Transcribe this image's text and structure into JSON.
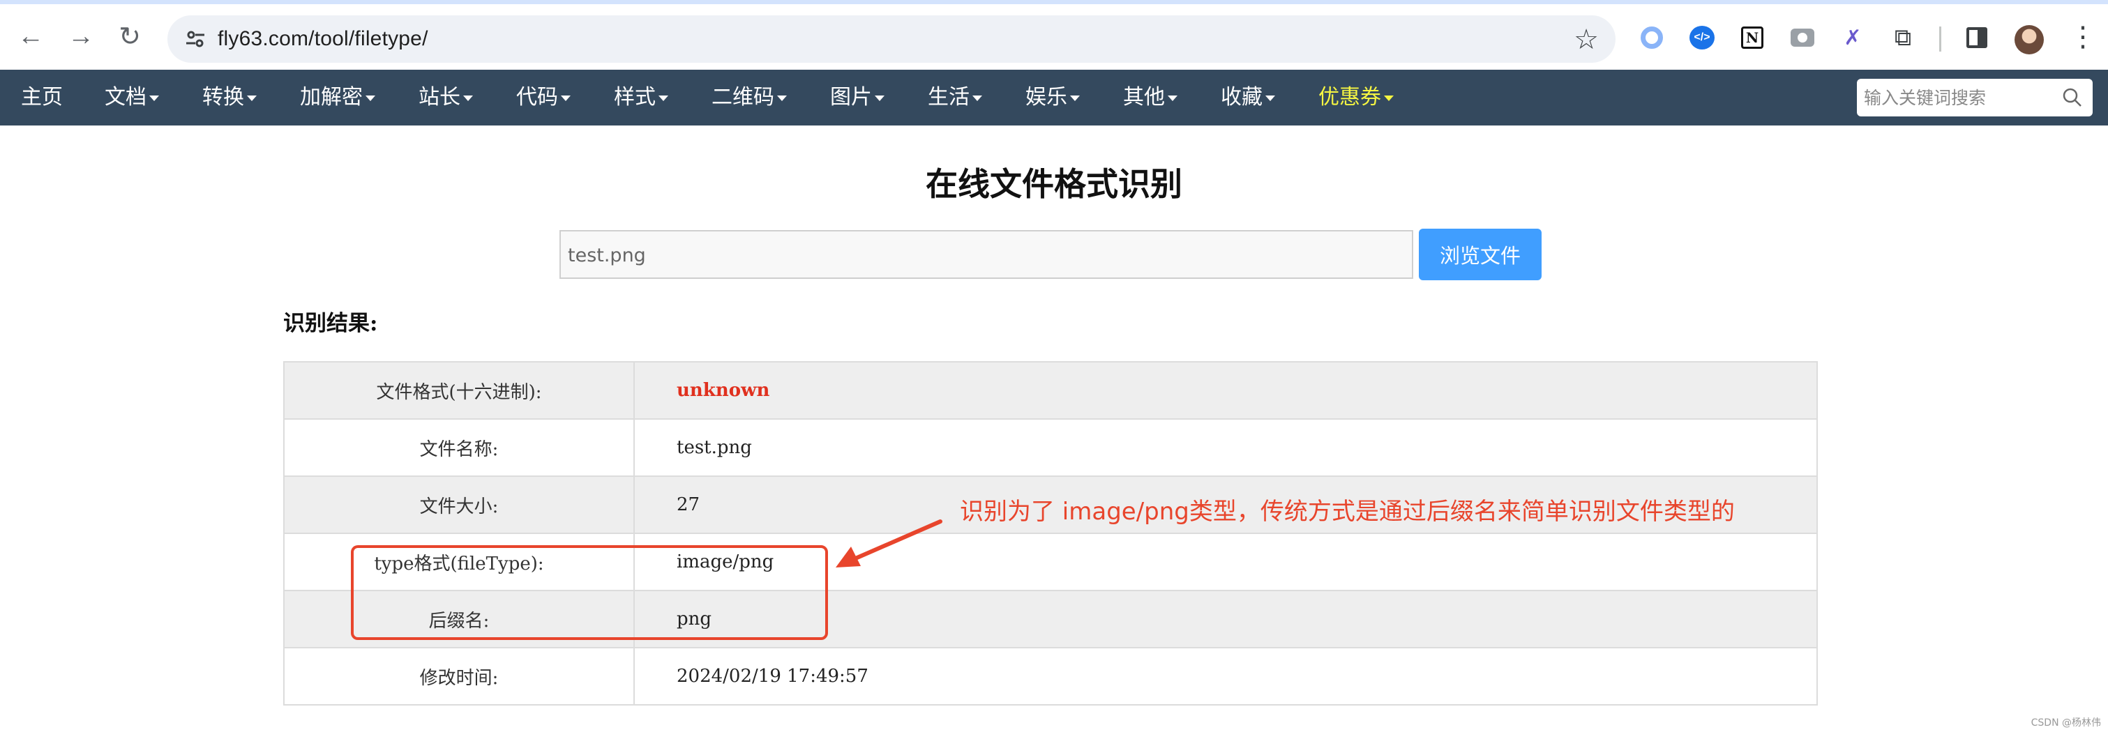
{
  "browser": {
    "url": "fly63.com/tool/filetype/"
  },
  "site_nav": {
    "items": [
      {
        "label": "主页",
        "has_caret": false
      },
      {
        "label": "文档",
        "has_caret": true
      },
      {
        "label": "转换",
        "has_caret": true
      },
      {
        "label": "加解密",
        "has_caret": true
      },
      {
        "label": "站长",
        "has_caret": true
      },
      {
        "label": "代码",
        "has_caret": true
      },
      {
        "label": "样式",
        "has_caret": true
      },
      {
        "label": "二维码",
        "has_caret": true
      },
      {
        "label": "图片",
        "has_caret": true
      },
      {
        "label": "生活",
        "has_caret": true
      },
      {
        "label": "娱乐",
        "has_caret": true
      },
      {
        "label": "其他",
        "has_caret": true
      },
      {
        "label": "收藏",
        "has_caret": true
      },
      {
        "label": "优惠券",
        "has_caret": true,
        "highlight_color": "#f5f542"
      }
    ],
    "search_placeholder": "输入关键词搜索"
  },
  "main": {
    "title": "在线文件格式识别",
    "file_input_value": "test.png",
    "browse_button": "浏览文件",
    "result_heading": "识别结果:",
    "rows": [
      {
        "key": "文件格式(十六进制):",
        "value": "unknown"
      },
      {
        "key": "文件名称:",
        "value": "test.png"
      },
      {
        "key": "文件大小:",
        "value": "27"
      },
      {
        "key": "type格式(fileType):",
        "value": "image/png"
      },
      {
        "key": "后缀名:",
        "value": "png"
      },
      {
        "key": "修改时间:",
        "value": "2024/02/19 17:49:57"
      }
    ]
  },
  "annotation": {
    "text": "识别为了 image/png类型，传统方式是通过后缀名来简单识别文件类型的",
    "color": "#e8452c"
  },
  "watermark": "CSDN @杨林伟",
  "colors": {
    "nav_bg": "#34495e",
    "button_blue": "#409eff",
    "unknown_red": "#e0301e"
  }
}
